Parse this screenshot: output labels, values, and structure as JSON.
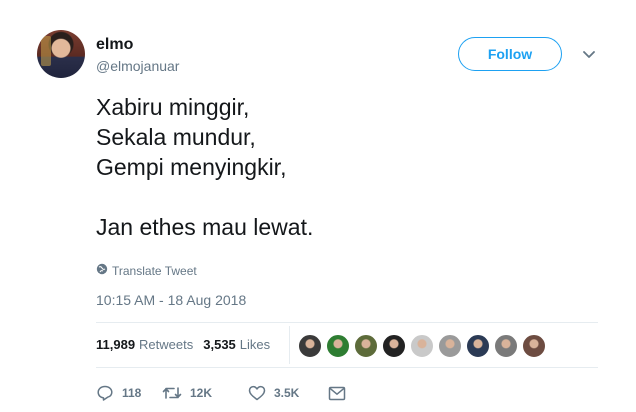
{
  "user": {
    "name": "elmo",
    "handle": "@elmojanuar"
  },
  "follow_label": "Follow",
  "tweet": {
    "text": "Xabiru minggir,\nSekala mundur,\nGempi menyingkir,\n\nJan ethes mau lewat."
  },
  "translate_label": "Translate Tweet",
  "timestamp": "10:15 AM - 18 Aug 2018",
  "stats": {
    "retweets_count": "11,989",
    "retweets_label": "Retweets",
    "likes_count": "3,535",
    "likes_label": "Likes"
  },
  "likers": [
    {
      "color": "#3a3a3a"
    },
    {
      "color": "#2e7d32"
    },
    {
      "color": "#5d6b3a"
    },
    {
      "color": "#222222"
    },
    {
      "color": "#c9c9c9"
    },
    {
      "color": "#9a9a9a"
    },
    {
      "color": "#2b3a55"
    },
    {
      "color": "#7a7a7a"
    },
    {
      "color": "#6d4c41"
    }
  ],
  "actions": {
    "reply_count": "118",
    "retweet_count": "12K",
    "like_count": "3.5K"
  },
  "colors": {
    "accent": "#1da1f2",
    "muted": "#657786",
    "text": "#14171a",
    "divider": "#e6ecf0"
  },
  "icons": {
    "caret": "chevron-down-icon",
    "translate": "globe-icon",
    "reply": "reply-icon",
    "retweet": "retweet-icon",
    "like": "heart-icon",
    "dm": "envelope-icon"
  }
}
